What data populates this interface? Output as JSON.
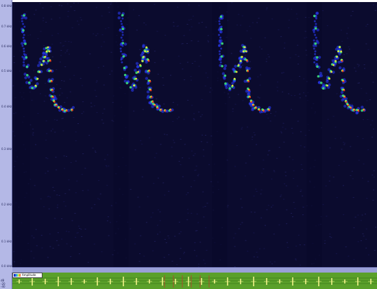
{
  "freq_ruler": {
    "ticks": [
      "0.8 kHz",
      "0.7 kHz",
      "0.6 kHz",
      "0.5 kHz",
      "0.4 kHz",
      "0.3 kHz",
      "0.2 kHz",
      "0.1 kHz",
      "0.0 kHz"
    ]
  },
  "time_ruler": {
    "ticks": [
      "",
      "",
      "",
      "",
      ""
    ]
  },
  "waveform": {
    "amp_labels": [
      "dB",
      "-20",
      "-40"
    ],
    "legend_label": "Amplitude"
  },
  "colors": {
    "background": "#0b0b2e",
    "ruler": "#b4b8e6",
    "waveform_bg": "#5aa02a",
    "waveform_grid": "#c0392b",
    "waveform_signal": "#f4f48a",
    "heat_low": "#2a3cff",
    "heat_mid": "#3ce07a",
    "heat_high": "#f1e63b",
    "heat_peak": "#e53a1a"
  },
  "calls": [
    {
      "start_fraction": 0.03
    },
    {
      "start_fraction": 0.3
    },
    {
      "start_fraction": 0.57
    },
    {
      "start_fraction": 0.83
    }
  ]
}
